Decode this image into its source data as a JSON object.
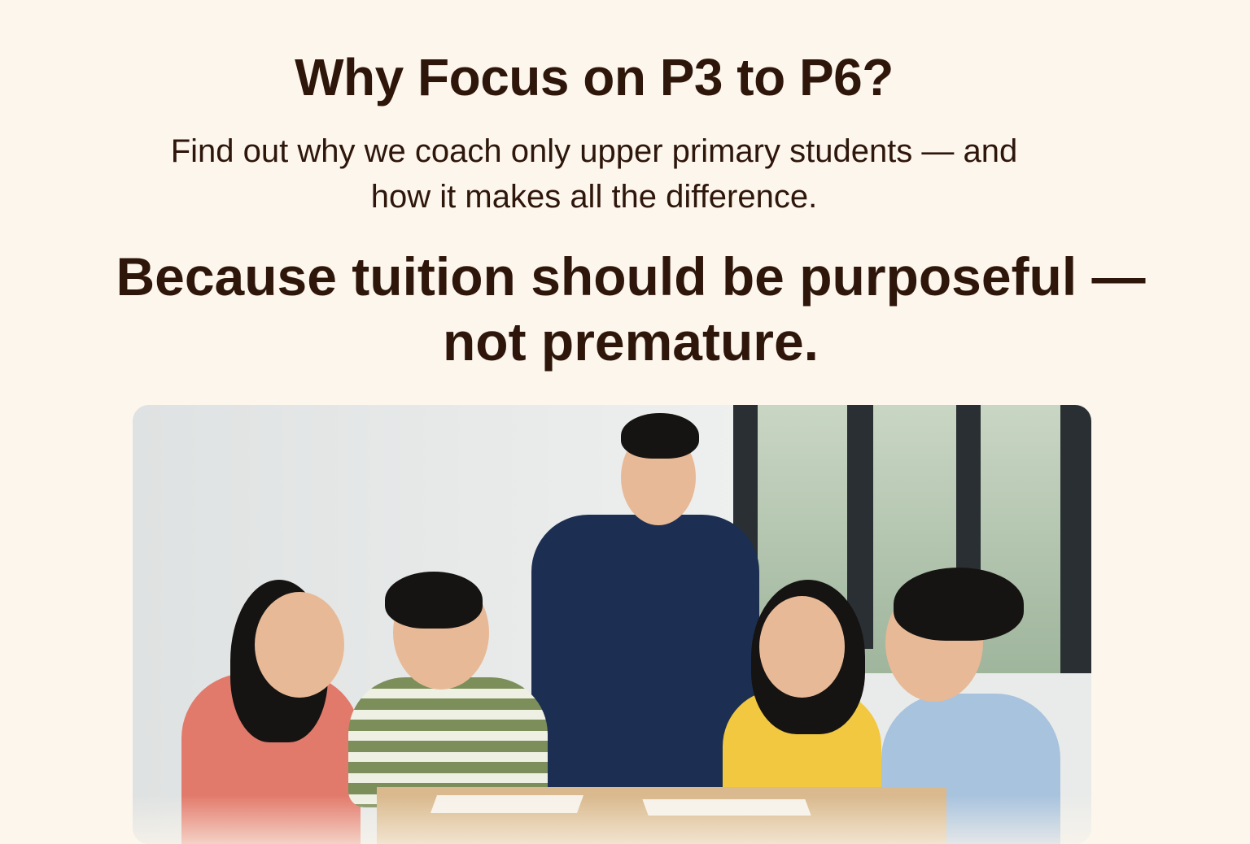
{
  "header": {
    "title": "Why Focus on P3 to P6?",
    "subtitle": "Find out why we coach only upper primary students — and how it makes all the difference."
  },
  "main": {
    "headline": "Because tuition should be purposeful — not premature."
  },
  "colors": {
    "background": "#fcf6ec",
    "text": "#2e160b"
  }
}
